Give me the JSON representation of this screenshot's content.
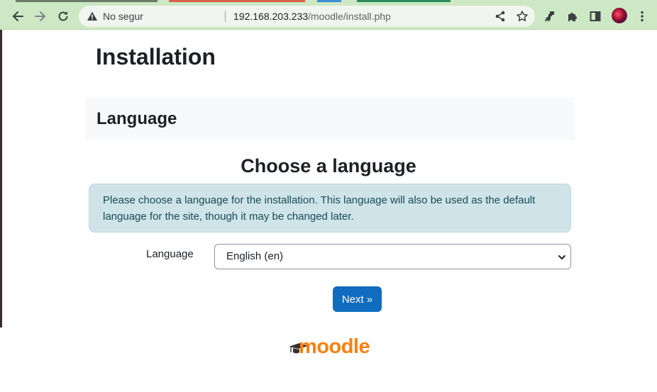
{
  "browser": {
    "security_label": "No segur",
    "url_host": "192.168.203.233",
    "url_path": "/moodle/install.php",
    "icons": [
      "back-arrow-icon",
      "forward-arrow-icon",
      "reload-icon",
      "warning-icon",
      "share-icon",
      "star-icon",
      "dino-extension-icon",
      "puzzle-icon",
      "side-panel-icon",
      "profile-avatar",
      "kebab-menu-icon"
    ],
    "colors": {
      "toolbar": "#cde8c4",
      "omnibox": "#f1f5ef"
    }
  },
  "page": {
    "title": "Installation",
    "section_title": "Language",
    "heading": "Choose a language",
    "info_text": "Please choose a language for the installation. This language will also be used as the default language for the site, though it may be changed later.",
    "language_label": "Language",
    "language_selected": "English (en)",
    "next_button": "Next »",
    "logo_text": "moodle"
  },
  "colors": {
    "primary": "#0f6cbf",
    "info_bg": "#cfe4e9",
    "info_text": "#174b57",
    "logo": "#f98012"
  }
}
